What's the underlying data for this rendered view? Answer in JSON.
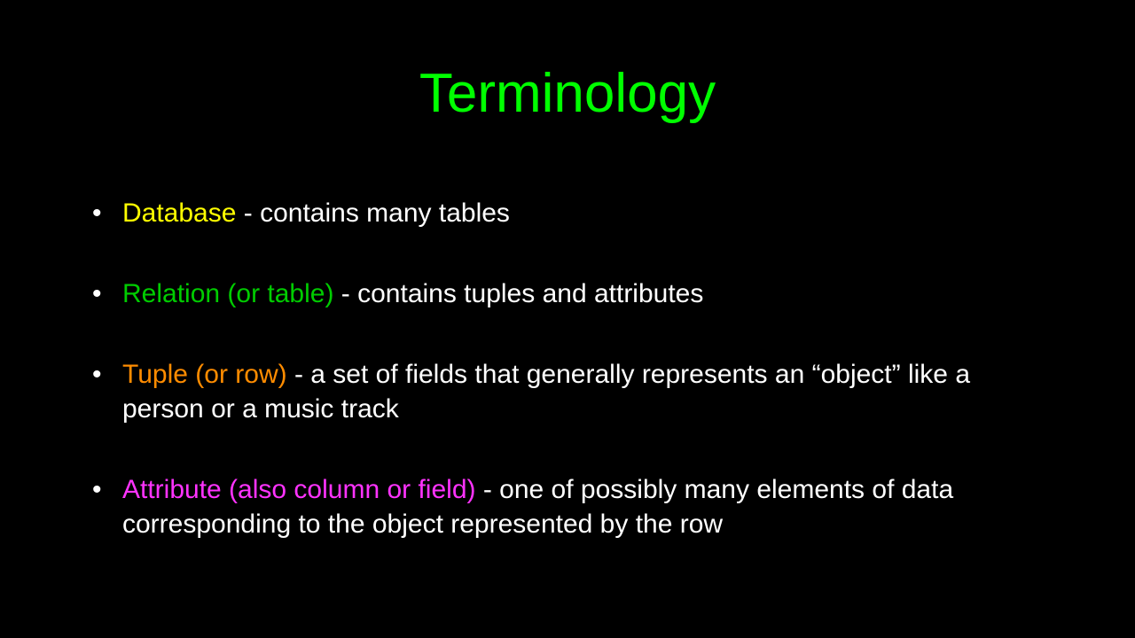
{
  "title": "Terminology",
  "bullets": [
    {
      "term": "Database",
      "desc": " - contains many tables",
      "colorClass": "c-yellow"
    },
    {
      "term": "Relation (or table)",
      "desc": " - contains tuples and attributes",
      "colorClass": "c-green"
    },
    {
      "term": "Tuple (or row)",
      "desc": " - a set of fields that generally represents an “object” like a person or a music track",
      "colorClass": "c-orange"
    },
    {
      "term": "Attribute (also column or field)",
      "desc": " - one of possibly many elements of data corresponding to the object represented by the row",
      "colorClass": "c-magenta"
    }
  ]
}
